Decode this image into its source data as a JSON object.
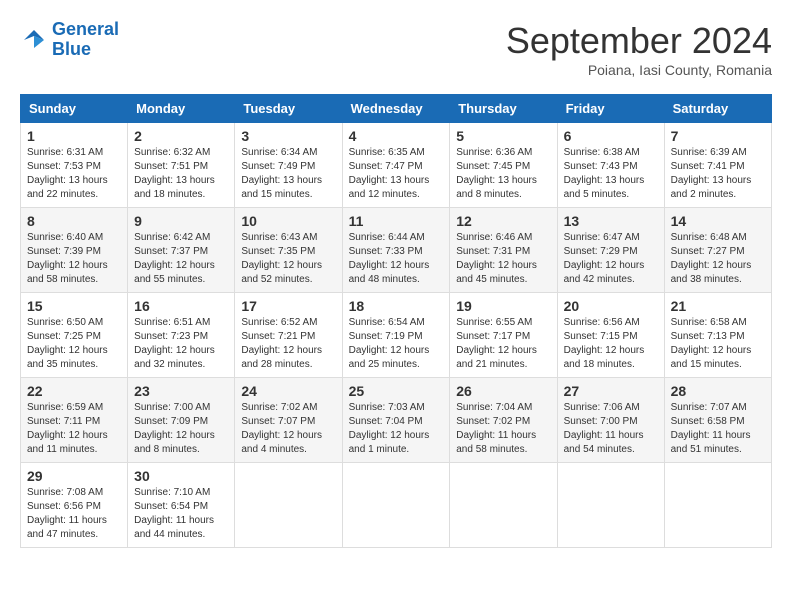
{
  "header": {
    "logo": {
      "line1": "General",
      "line2": "Blue"
    },
    "title": "September 2024",
    "subtitle": "Poiana, Iasi County, Romania"
  },
  "calendar": {
    "headers": [
      "Sunday",
      "Monday",
      "Tuesday",
      "Wednesday",
      "Thursday",
      "Friday",
      "Saturday"
    ],
    "weeks": [
      [
        {
          "day": "1",
          "sunrise": "6:31 AM",
          "sunset": "7:53 PM",
          "daylight": "13 hours and 22 minutes."
        },
        {
          "day": "2",
          "sunrise": "6:32 AM",
          "sunset": "7:51 PM",
          "daylight": "13 hours and 18 minutes."
        },
        {
          "day": "3",
          "sunrise": "6:34 AM",
          "sunset": "7:49 PM",
          "daylight": "13 hours and 15 minutes."
        },
        {
          "day": "4",
          "sunrise": "6:35 AM",
          "sunset": "7:47 PM",
          "daylight": "13 hours and 12 minutes."
        },
        {
          "day": "5",
          "sunrise": "6:36 AM",
          "sunset": "7:45 PM",
          "daylight": "13 hours and 8 minutes."
        },
        {
          "day": "6",
          "sunrise": "6:38 AM",
          "sunset": "7:43 PM",
          "daylight": "13 hours and 5 minutes."
        },
        {
          "day": "7",
          "sunrise": "6:39 AM",
          "sunset": "7:41 PM",
          "daylight": "13 hours and 2 minutes."
        }
      ],
      [
        {
          "day": "8",
          "sunrise": "6:40 AM",
          "sunset": "7:39 PM",
          "daylight": "12 hours and 58 minutes."
        },
        {
          "day": "9",
          "sunrise": "6:42 AM",
          "sunset": "7:37 PM",
          "daylight": "12 hours and 55 minutes."
        },
        {
          "day": "10",
          "sunrise": "6:43 AM",
          "sunset": "7:35 PM",
          "daylight": "12 hours and 52 minutes."
        },
        {
          "day": "11",
          "sunrise": "6:44 AM",
          "sunset": "7:33 PM",
          "daylight": "12 hours and 48 minutes."
        },
        {
          "day": "12",
          "sunrise": "6:46 AM",
          "sunset": "7:31 PM",
          "daylight": "12 hours and 45 minutes."
        },
        {
          "day": "13",
          "sunrise": "6:47 AM",
          "sunset": "7:29 PM",
          "daylight": "12 hours and 42 minutes."
        },
        {
          "day": "14",
          "sunrise": "6:48 AM",
          "sunset": "7:27 PM",
          "daylight": "12 hours and 38 minutes."
        }
      ],
      [
        {
          "day": "15",
          "sunrise": "6:50 AM",
          "sunset": "7:25 PM",
          "daylight": "12 hours and 35 minutes."
        },
        {
          "day": "16",
          "sunrise": "6:51 AM",
          "sunset": "7:23 PM",
          "daylight": "12 hours and 32 minutes."
        },
        {
          "day": "17",
          "sunrise": "6:52 AM",
          "sunset": "7:21 PM",
          "daylight": "12 hours and 28 minutes."
        },
        {
          "day": "18",
          "sunrise": "6:54 AM",
          "sunset": "7:19 PM",
          "daylight": "12 hours and 25 minutes."
        },
        {
          "day": "19",
          "sunrise": "6:55 AM",
          "sunset": "7:17 PM",
          "daylight": "12 hours and 21 minutes."
        },
        {
          "day": "20",
          "sunrise": "6:56 AM",
          "sunset": "7:15 PM",
          "daylight": "12 hours and 18 minutes."
        },
        {
          "day": "21",
          "sunrise": "6:58 AM",
          "sunset": "7:13 PM",
          "daylight": "12 hours and 15 minutes."
        }
      ],
      [
        {
          "day": "22",
          "sunrise": "6:59 AM",
          "sunset": "7:11 PM",
          "daylight": "12 hours and 11 minutes."
        },
        {
          "day": "23",
          "sunrise": "7:00 AM",
          "sunset": "7:09 PM",
          "daylight": "12 hours and 8 minutes."
        },
        {
          "day": "24",
          "sunrise": "7:02 AM",
          "sunset": "7:07 PM",
          "daylight": "12 hours and 4 minutes."
        },
        {
          "day": "25",
          "sunrise": "7:03 AM",
          "sunset": "7:04 PM",
          "daylight": "12 hours and 1 minute."
        },
        {
          "day": "26",
          "sunrise": "7:04 AM",
          "sunset": "7:02 PM",
          "daylight": "11 hours and 58 minutes."
        },
        {
          "day": "27",
          "sunrise": "7:06 AM",
          "sunset": "7:00 PM",
          "daylight": "11 hours and 54 minutes."
        },
        {
          "day": "28",
          "sunrise": "7:07 AM",
          "sunset": "6:58 PM",
          "daylight": "11 hours and 51 minutes."
        }
      ],
      [
        {
          "day": "29",
          "sunrise": "7:08 AM",
          "sunset": "6:56 PM",
          "daylight": "11 hours and 47 minutes."
        },
        {
          "day": "30",
          "sunrise": "7:10 AM",
          "sunset": "6:54 PM",
          "daylight": "11 hours and 44 minutes."
        },
        null,
        null,
        null,
        null,
        null
      ]
    ]
  }
}
